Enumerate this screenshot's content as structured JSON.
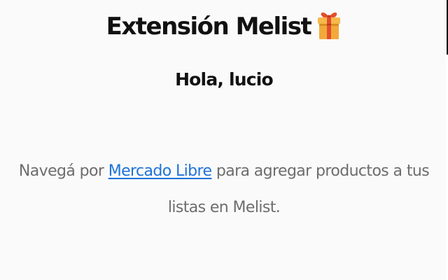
{
  "header": {
    "title": "Extensión Melist",
    "title_icon": "gift-icon"
  },
  "greeting": {
    "text": "Hola, lucio"
  },
  "message": {
    "before_link": "Navegá por ",
    "link_label": "Mercado Libre",
    "after_link": " para agregar productos a tus listas en Melist."
  },
  "colors": {
    "background": "#fafafa",
    "heading": "#111111",
    "body_text": "#6d6d6d",
    "link": "#1f73d8",
    "gift_box": "#f2a93b",
    "gift_ribbon": "#e24e2b"
  }
}
